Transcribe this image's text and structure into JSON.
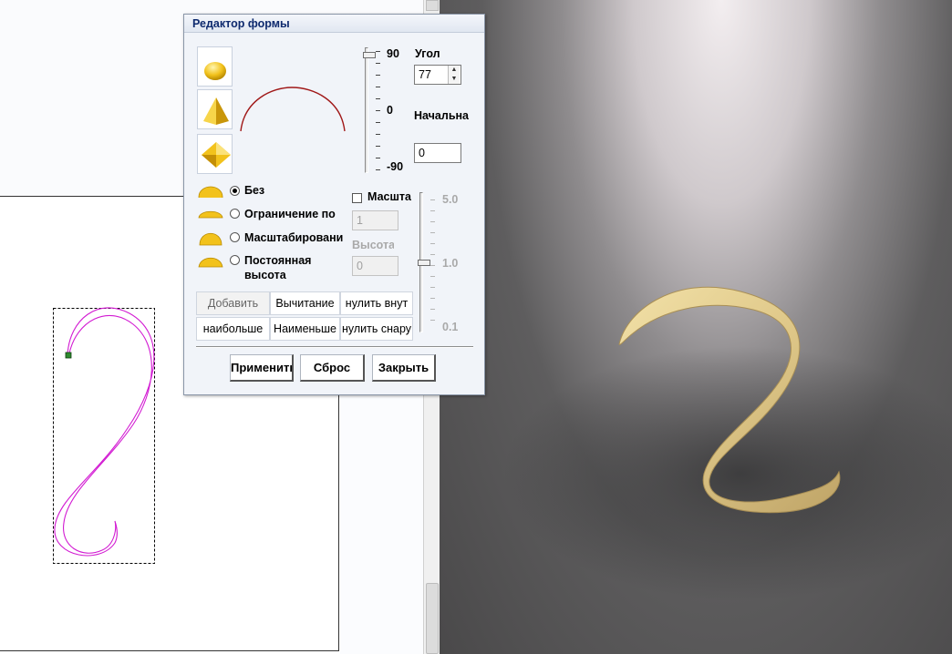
{
  "dialog": {
    "title": "Редактор формы",
    "angle_slider": {
      "max_label": "90",
      "mid_label": "0",
      "min_label": "-90",
      "value": 77
    },
    "angle": {
      "label": "Угол",
      "value": "77"
    },
    "start": {
      "label": "Начальна",
      "value": "0"
    },
    "limit_options": [
      {
        "label": "Без",
        "selected": true
      },
      {
        "label": "Ограничение по",
        "selected": false
      },
      {
        "label": "Масштабировани",
        "selected": false
      },
      {
        "label": "Постоянная высота",
        "line1": "Постоянная",
        "line2": "высота",
        "selected": false
      }
    ],
    "scale": {
      "checkbox_label": "Масшта",
      "checked": false,
      "value": "1",
      "height_label": "Высота",
      "height_value": "0"
    },
    "scale_slider": {
      "max_label": "5.0",
      "mid_label": "1.0",
      "min_label": "0.1",
      "value": 1.0
    },
    "combine_buttons": [
      [
        "Добавить",
        "Вычитание",
        "нулить внут"
      ],
      [
        "наибольше",
        "Наименьше",
        "нулить снару"
      ]
    ],
    "actions": {
      "apply": "Применить",
      "reset": "Сброс",
      "close": "Закрыть"
    }
  },
  "colors": {
    "title_text": "#0e2a6e",
    "curve_2d": "#d21ad2",
    "profile_arc": "#a01818",
    "gold": "#f2c21c",
    "relief": "#e3cf93"
  },
  "icons": [
    "dome-icon",
    "pyramid-icon",
    "diamond-icon"
  ]
}
